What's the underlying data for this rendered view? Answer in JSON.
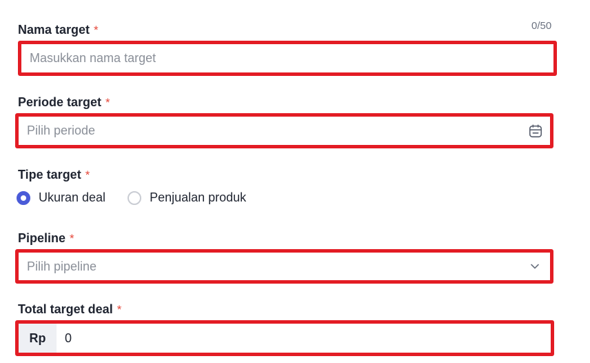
{
  "nama_target": {
    "label": "Nama target",
    "required_mark": "*",
    "counter": "0/50",
    "placeholder": "Masukkan nama target",
    "value": ""
  },
  "periode_target": {
    "label": "Periode target",
    "required_mark": "*",
    "placeholder": "Pilih periode",
    "icon": "calendar-icon"
  },
  "tipe_target": {
    "label": "Tipe target",
    "required_mark": "*",
    "options": [
      {
        "label": "Ukuran deal",
        "selected": true
      },
      {
        "label": "Penjualan produk",
        "selected": false
      }
    ],
    "accent_color": "#4a5bd8"
  },
  "pipeline": {
    "label": "Pipeline",
    "required_mark": "*",
    "placeholder": "Pilih pipeline",
    "icon": "chevron-down-icon"
  },
  "total_target_deal": {
    "label": "Total target deal",
    "required_mark": "*",
    "prefix": "Rp",
    "value": "0"
  },
  "colors": {
    "highlight_border": "#e31c24",
    "required": "#e5483a",
    "placeholder": "#8a8f98"
  }
}
